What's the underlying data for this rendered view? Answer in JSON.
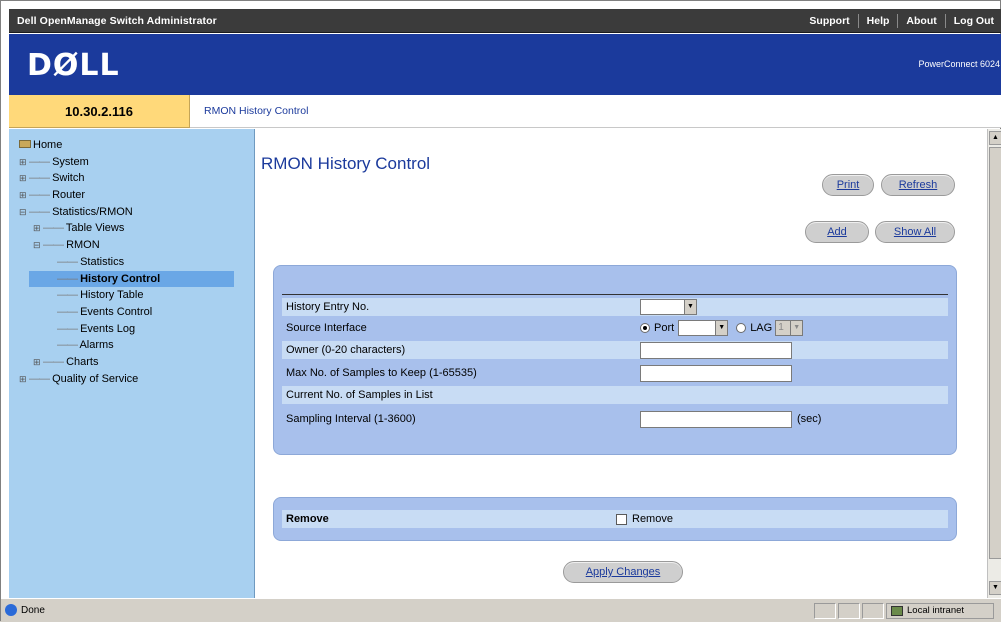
{
  "topbar": {
    "title": "Dell OpenManage Switch Administrator",
    "links": [
      "Support",
      "Help",
      "About",
      "Log Out"
    ]
  },
  "header": {
    "logo": "DØLL",
    "model": "PowerConnect 6024"
  },
  "address": {
    "ip": "10.30.2.116",
    "path": "RMON History Control"
  },
  "sidebar": {
    "items": [
      {
        "label": "Home"
      },
      {
        "label": "System"
      },
      {
        "label": "Switch"
      },
      {
        "label": "Router"
      },
      {
        "label": "Statistics/RMON"
      },
      {
        "label": "Table Views"
      },
      {
        "label": "RMON"
      },
      {
        "label": "Statistics"
      },
      {
        "label": "History Control"
      },
      {
        "label": "History Table"
      },
      {
        "label": "Events Control"
      },
      {
        "label": "Events Log"
      },
      {
        "label": "Alarms"
      },
      {
        "label": "Charts"
      },
      {
        "label": "Quality of Service"
      }
    ]
  },
  "main": {
    "title": "RMON History Control",
    "buttons": {
      "print": "Print",
      "refresh": "Refresh",
      "add": "Add",
      "show_all": "Show All",
      "apply": "Apply Changes"
    },
    "form": {
      "history_entry": "History Entry No.",
      "source_interface": "Source Interface",
      "port_label": "Port",
      "lag_label": "LAG",
      "lag_value": "1",
      "owner": "Owner (0-20 characters)",
      "max_samples": "Max No. of Samples to Keep (1-65535)",
      "current_samples": "Current No. of Samples in List",
      "sampling_interval": "Sampling Interval (1-3600)",
      "sec_unit": "(sec)"
    },
    "remove": {
      "label": "Remove",
      "checkbox_label": "Remove"
    }
  },
  "statusbar": {
    "status": "Done",
    "zone": "Local intranet"
  }
}
